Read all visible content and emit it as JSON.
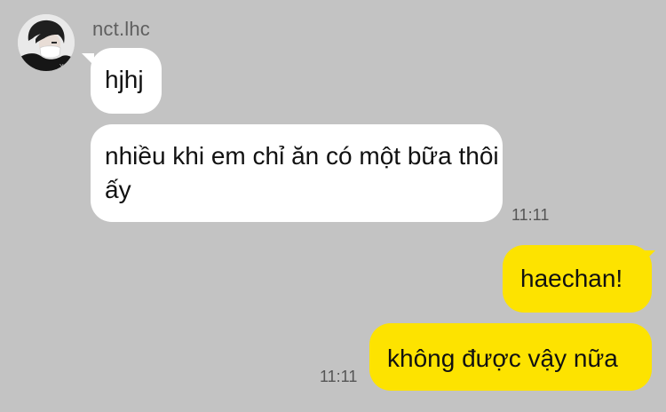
{
  "conversation": {
    "sender": {
      "name": "nct.lhc",
      "avatar_icon": "profile-photo-avatar"
    },
    "messages": [
      {
        "direction": "incoming",
        "text": "hjhj",
        "time": ""
      },
      {
        "direction": "incoming",
        "text": "nhiều khi em chỉ ăn có một bữa thôi ấy",
        "time": "11:11"
      },
      {
        "direction": "outgoing",
        "text": "haechan!",
        "time": ""
      },
      {
        "direction": "outgoing",
        "text": "không được vậy nữa",
        "time": "11:11"
      }
    ]
  },
  "colors": {
    "background": "#c3c3c3",
    "incoming_bubble": "#ffffff",
    "outgoing_bubble": "#fde300",
    "timestamp": "#555555",
    "sender_name": "#5f5f5f"
  }
}
